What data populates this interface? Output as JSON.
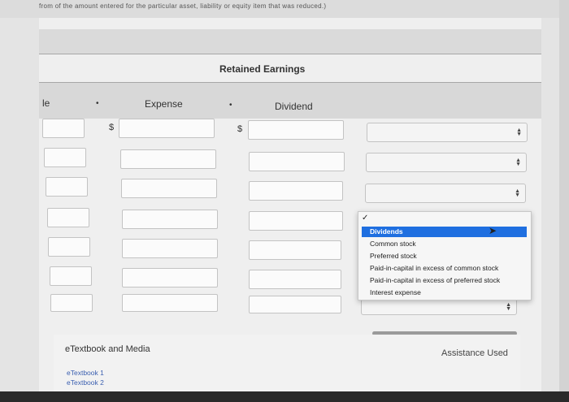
{
  "cut_top_text": "from of the amount entered for the particular asset, liability or equity item that was reduced.)",
  "section_title": "Retained Earnings",
  "columns": {
    "left_partial": "le",
    "expense": "Expense",
    "dividend": "Dividend"
  },
  "currency_symbol": "$",
  "dropdown": {
    "selected": "Dividends",
    "options": [
      "Dividends",
      "Common stock",
      "Preferred stock",
      "Paid-in-capital in excess of common stock",
      "Paid-in-capital in excess of preferred stock",
      "Interest expense"
    ]
  },
  "footer": {
    "etextbook_label": "eTextbook and Media",
    "assistance_used": "Assistance Used",
    "links": [
      "eTextbook 1",
      "eTextbook 2"
    ]
  },
  "icons": {
    "select_arrow": "updown-arrow-icon",
    "checkmark": "check-icon",
    "cursor": "mouse-pointer-icon"
  },
  "colors": {
    "highlight": "#1f6fe0",
    "link": "#3b5fb0"
  }
}
